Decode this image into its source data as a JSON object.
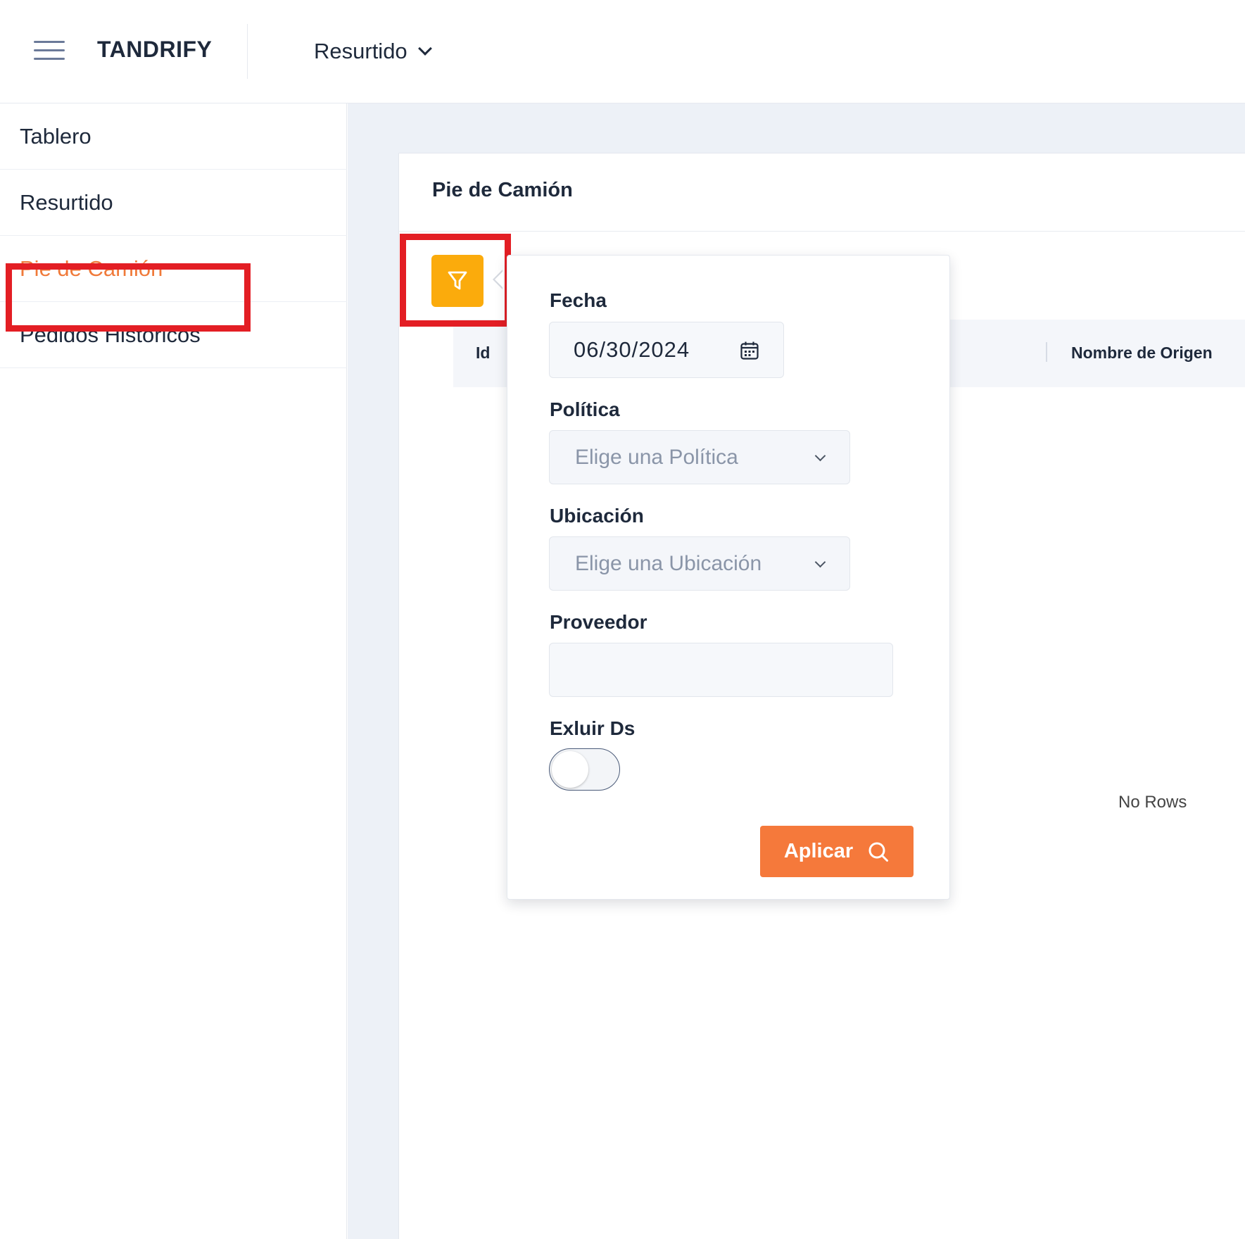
{
  "header": {
    "brand": "TANDRIFY",
    "module": "Resurtido"
  },
  "sidebar": {
    "items": [
      {
        "label": "Tablero"
      },
      {
        "label": "Resurtido"
      },
      {
        "label": "Pie de Camión"
      },
      {
        "label": "Pedidos Históricos"
      }
    ]
  },
  "card": {
    "title": "Pie de Camión"
  },
  "table": {
    "columns": [
      "Id",
      "Nombre de Origen"
    ],
    "empty_text": "No Rows"
  },
  "filter": {
    "fecha_label": "Fecha",
    "fecha_value": "06/30/2024",
    "politica_label": "Política",
    "politica_placeholder": "Elige una Política",
    "ubicacion_label": "Ubicación",
    "ubicacion_placeholder": "Elige una Ubicación",
    "proveedor_label": "Proveedor",
    "proveedor_value": "",
    "exluir_label": "Exluir Ds",
    "exluir_on": false,
    "apply_label": "Aplicar"
  },
  "colors": {
    "accent": "#f5793b",
    "filter_button": "#fbab0c",
    "highlight": "#e31e24"
  },
  "icons": {
    "menu": "hamburger-menu-icon",
    "filter": "funnel-icon",
    "calendar": "calendar-icon",
    "search": "search-icon"
  }
}
